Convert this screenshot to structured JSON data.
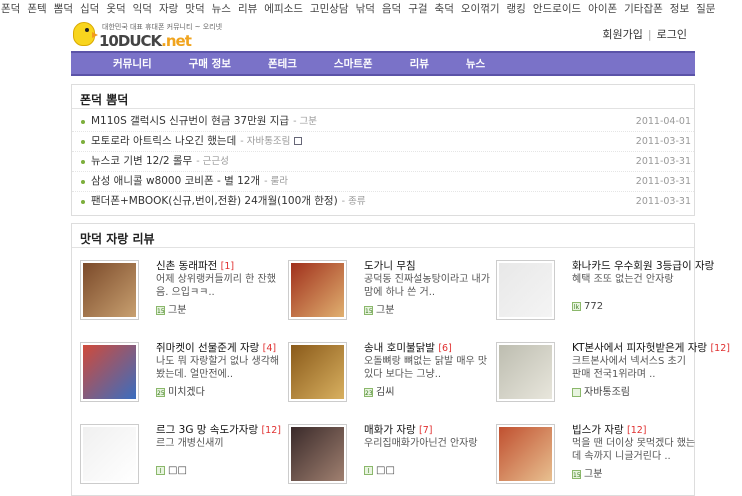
{
  "top_nav": [
    "폰덕",
    "폰텍",
    "뽐덕",
    "십덕",
    "옷덕",
    "익덕",
    "자랑",
    "맛덕",
    "뉴스",
    "리뷰",
    "에피소드",
    "고민상담",
    "낚덕",
    "음덕",
    "구걸",
    "축덕",
    "오이꺾기",
    "랭킹",
    "안드로이드",
    "아이폰",
    "기타잡폰",
    "정보",
    "질문"
  ],
  "logo": {
    "tagline": "대한민국 대표 휴대폰 커뮤니티 ~ 오리넷",
    "name_part1": "10DUCK",
    "name_part2": ".net"
  },
  "auth": {
    "signup": "회원가입",
    "login": "로그인"
  },
  "main_nav": [
    "커뮤니티",
    "구매 정보",
    "폰테크",
    "스마트폰",
    "리뷰",
    "뉴스"
  ],
  "hot_section": {
    "title": "폰덕 뽐덕",
    "posts": [
      {
        "title": "M110S 갤럭시S 신규번이 현금 37만원 지급",
        "author": "- 그분",
        "date": "2011-04-01"
      },
      {
        "title": "모토로라 아트릭스 나오긴 했는데",
        "author": "- 자바통조림",
        "date": "2011-03-31"
      },
      {
        "title": "뉴스코 기변 12/2 롤무",
        "author": "- 근근성",
        "date": "2011-03-31"
      },
      {
        "title": "삼성 애니콜 w8000 코비폰 - 별 12개",
        "author": "- 룰라",
        "date": "2011-03-31"
      },
      {
        "title": "팬더폰+MBOOK(신규,번이,전환) 24개월(100개 한정)",
        "author": "- 종류",
        "date": "2011-03-31"
      }
    ]
  },
  "review_section": {
    "title": "맛덕 자랑 리뷰",
    "items": [
      {
        "title": "신촌 동래파전",
        "count": "[1]",
        "desc": "어제 상위랭커들끼리 한 잔했음. 으입ㅋㅋ..",
        "user": "그분",
        "level": "15",
        "colors": [
          "#7b4a2a",
          "#c8a070"
        ]
      },
      {
        "title": "도가니 무침",
        "count": "",
        "desc": "공덕동 진짜설농탕이라고 내가 맘에 하나 쓴 거..",
        "user": "그분",
        "level": "15",
        "colors": [
          "#a0301c",
          "#e0b070"
        ]
      },
      {
        "title": "화나카드 우수회원 3등급이 자랑",
        "count": "",
        "desc": "혜택 조또 없는건 안자랑",
        "user": "772",
        "level": "lk",
        "colors": [
          "#e8e8e8",
          "#f4f4f4"
        ]
      },
      {
        "title": "쥐마켓이 선물준게 자랑",
        "count": "[4]",
        "desc": "나도 뭐 자랑할거 없나 생각해봤는데. 얼만전에..",
        "user": "미치겠다",
        "level": "25",
        "colors": [
          "#d04a3a",
          "#3a6ec0"
        ]
      },
      {
        "title": "송내 호미불닭발",
        "count": "[6]",
        "desc": "오돌뼈랑 뼈없는 닭발 매우 맛있다 보다는 그냥..",
        "user": "김씨",
        "level": "23",
        "colors": [
          "#8a5a1a",
          "#d8b060"
        ]
      },
      {
        "title": "KT본사에서 피자헛받은게 자랑",
        "count": "[12]",
        "desc": "크트본사에서 넥서스S 초기 판매 전국1위라며 ..",
        "user": "자바통조림",
        "level": "",
        "colors": [
          "#bdbdb0",
          "#e8e6dc"
        ]
      },
      {
        "title": "르그 3G 망 속도가자랑",
        "count": "[12]",
        "desc": "르그 개병신새끼",
        "user": "□□",
        "level": "l",
        "colors": [
          "#f0f0f0",
          "#ffffff"
        ]
      },
      {
        "title": "매화가 자랑",
        "count": "[7]",
        "desc": "우리집매화가아닌건 안자랑",
        "user": "□□",
        "level": "l",
        "colors": [
          "#3a2a2a",
          "#a08070"
        ]
      },
      {
        "title": "빕스가 자랑",
        "count": "[12]",
        "desc": "먹을 땐 더이상 못먹겠다 했는데 속까지 니글거린다 ..",
        "user": "그분",
        "level": "15",
        "colors": [
          "#c05030",
          "#e8c090"
        ]
      }
    ]
  }
}
